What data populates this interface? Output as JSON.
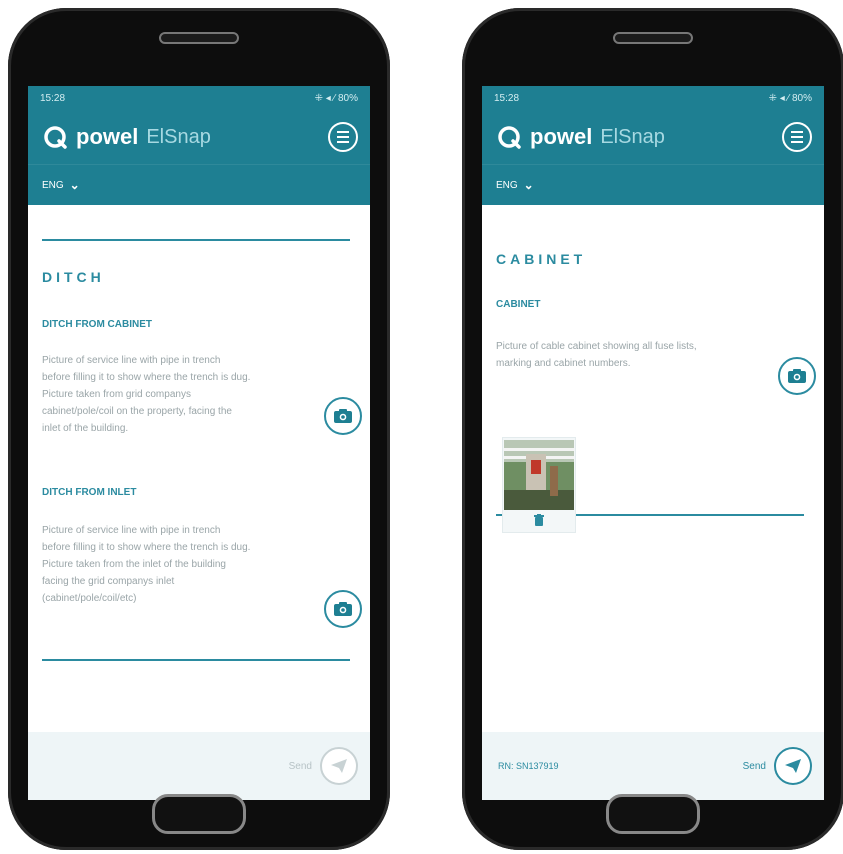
{
  "colors": {
    "accent": "#1e7f92",
    "link": "#2b8ba0",
    "desc_text": "#9aa5a8",
    "footer_bg": "#eef5f7"
  },
  "left_phone": {
    "status": {
      "time": "15:28",
      "indicators": "⁜ ◂ ⁄ 80%"
    },
    "app": {
      "brand": "powel",
      "product": "ElSnap"
    },
    "lang": "ENG",
    "section_title": "DITCH",
    "items": [
      {
        "title": "DITCH FROM CABINET",
        "lines": [
          "Picture of service line with pipe in trench",
          "before filling it to show where the trench is dug.",
          "Picture taken from grid companys",
          "cabinet/pole/coil on the property, facing the",
          "inlet of the building."
        ],
        "camera_icon": "camera-icon"
      },
      {
        "title": "DITCH FROM INLET",
        "lines": [
          "Picture of service line with pipe in trench",
          "before filling it to show where the trench is dug.",
          "Picture taken from the inlet of the building",
          "facing the grid companys inlet",
          "(cabinet/pole/coil/etc)"
        ],
        "camera_icon": "camera-icon"
      }
    ],
    "footer": {
      "send_label": "Send",
      "send_icon": "paper-plane-icon"
    }
  },
  "right_phone": {
    "status": {
      "time": "15:28",
      "indicators": "⁜ ◂ ⁄ 80%"
    },
    "app": {
      "brand": "powel",
      "product": "ElSnap"
    },
    "lang": "ENG",
    "section_title": "CABINET",
    "item": {
      "title": "CABINET",
      "lines": [
        "Picture of cable cabinet showing all fuse lists,",
        "marking and cabinet numbers."
      ],
      "camera_icon": "camera-icon",
      "thumbnail_icon": "trash-icon"
    },
    "footer": {
      "rn_label": "RN: SN137919",
      "send_label": "Send",
      "send_icon": "paper-plane-icon"
    }
  }
}
